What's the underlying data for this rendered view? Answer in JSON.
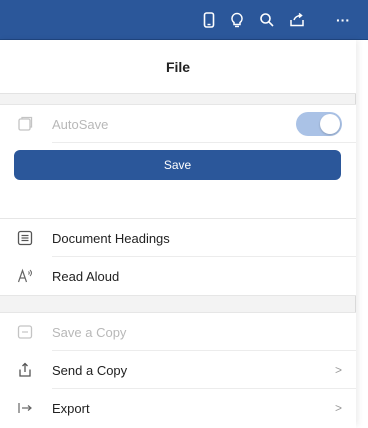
{
  "toolbar": {
    "icons": [
      "tablet-icon",
      "lightbulb-icon",
      "search-icon",
      "share-icon",
      "more-icon"
    ],
    "more_label": "···"
  },
  "panel": {
    "title": "File"
  },
  "autosave": {
    "label": "AutoSave",
    "enabled": true
  },
  "save": {
    "label": "Save"
  },
  "view_items": [
    {
      "label": "Document Headings",
      "icon": "list-icon"
    },
    {
      "label": "Read Aloud",
      "icon": "read-aloud-icon"
    }
  ],
  "file_items": [
    {
      "label": "Save a Copy",
      "icon": "save-copy-icon",
      "disabled": true,
      "chevron": ""
    },
    {
      "label": "Send a Copy",
      "icon": "send-icon",
      "disabled": false,
      "chevron": ">"
    },
    {
      "label": "Export",
      "icon": "export-icon",
      "disabled": false,
      "chevron": ">"
    }
  ],
  "colors": {
    "toolbar": "#2b579a",
    "save_button": "#2b579a",
    "toggle_on": "#aac2e6"
  }
}
